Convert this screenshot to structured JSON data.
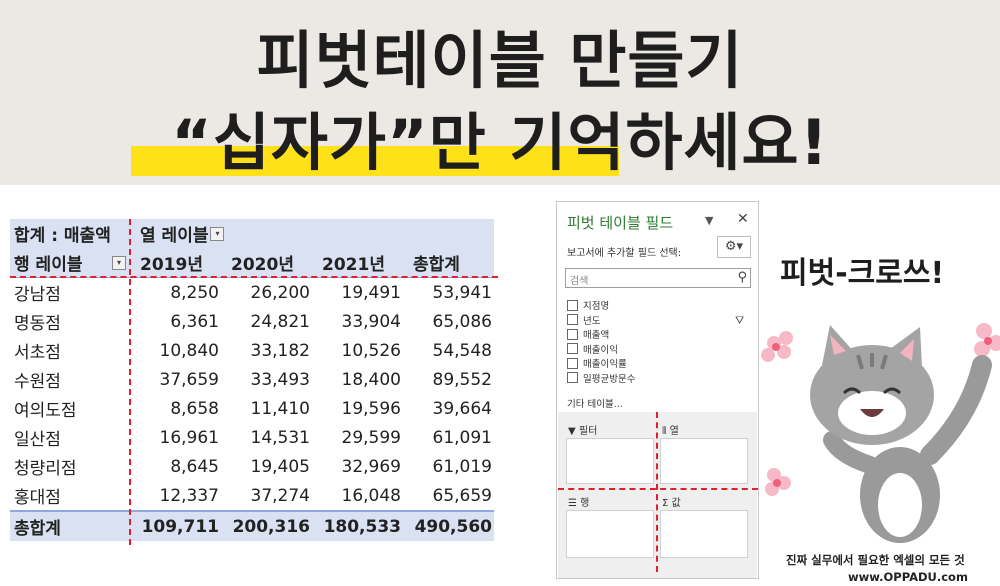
{
  "title": {
    "line1": "피벗테이블 만들기",
    "line2": "“십자가”만 기억하세요!"
  },
  "pivot": {
    "corner_label": "합계 : 매출액",
    "col_labels_title": "열 레이블",
    "row_labels_title": "행 레이블",
    "years": [
      "2019년",
      "2020년",
      "2021년",
      "총합계"
    ],
    "rows": [
      {
        "name": "강남점",
        "v": [
          "8,250",
          "26,200",
          "19,491",
          "53,941"
        ]
      },
      {
        "name": "명동점",
        "v": [
          "6,361",
          "24,821",
          "33,904",
          "65,086"
        ]
      },
      {
        "name": "서초점",
        "v": [
          "10,840",
          "33,182",
          "10,526",
          "54,548"
        ]
      },
      {
        "name": "수원점",
        "v": [
          "37,659",
          "33,493",
          "18,400",
          "89,552"
        ]
      },
      {
        "name": "여의도점",
        "v": [
          "8,658",
          "11,410",
          "19,596",
          "39,664"
        ]
      },
      {
        "name": "일산점",
        "v": [
          "16,961",
          "14,531",
          "29,599",
          "61,091"
        ]
      },
      {
        "name": "청량리점",
        "v": [
          "8,645",
          "19,405",
          "32,969",
          "61,019"
        ]
      },
      {
        "name": "홍대점",
        "v": [
          "12,337",
          "37,274",
          "16,048",
          "65,659"
        ]
      }
    ],
    "total": {
      "name": "총합계",
      "v": [
        "109,711",
        "200,316",
        "180,533",
        "490,560"
      ]
    }
  },
  "field_pane": {
    "title": "피벗 테이블 필드",
    "subtitle": "보고서에 추가할 필드 선택:",
    "search_placeholder": "검색",
    "fields": [
      "지점명",
      "년도",
      "매출액",
      "매출이익",
      "매출이익률",
      "일평균방문수"
    ],
    "more": "기타 테이블...",
    "areas": {
      "filter": "필터",
      "columns": "열",
      "rows": "행",
      "values": "Σ 값"
    }
  },
  "side": {
    "cross_text": "피벗-크로쓰!",
    "footer_line1": "진짜 실무에서 필요한 엑셀의 모든 것",
    "footer_line2": "www.OPPADU.com"
  },
  "colors": {
    "accent_red": "#e0202c",
    "highlight_yellow": "#ffe11a",
    "pivot_header": "#d9e1f2",
    "pane_title_green": "#2e7d32"
  }
}
